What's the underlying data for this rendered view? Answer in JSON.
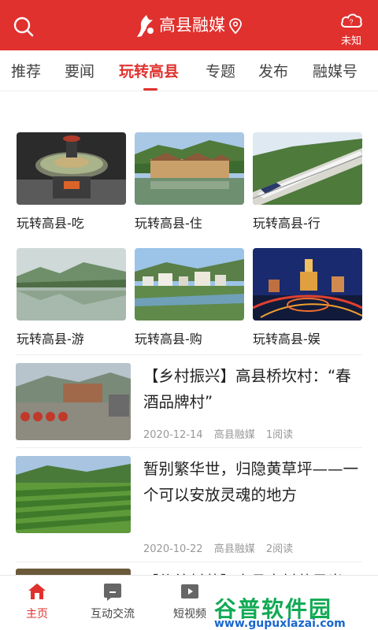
{
  "header": {
    "title": "高县融媒",
    "weather_label": "未知",
    "icons": [
      "search-icon",
      "logo-icon",
      "location-pin-icon",
      "weather-icon"
    ]
  },
  "tabs": [
    {
      "label": "推荐"
    },
    {
      "label": "要闻"
    },
    {
      "label": "玩转高县",
      "active": true
    },
    {
      "label": "专题"
    },
    {
      "label": "发布"
    },
    {
      "label": "融媒号"
    }
  ],
  "grid": [
    {
      "caption": "玩转高县-吃"
    },
    {
      "caption": "玩转高县-住"
    },
    {
      "caption": "玩转高县-行"
    },
    {
      "caption": "玩转高县-游"
    },
    {
      "caption": "玩转高县-购"
    },
    {
      "caption": "玩转高县-娱"
    }
  ],
  "news": [
    {
      "title": "【乡村振兴】高县桥坎村：“春酒品牌村”",
      "date": "2020-12-14",
      "source": "高县融媒",
      "reads": "1阅读"
    },
    {
      "title": "暂别繁华世，归隐黄草坪——一个可以安放灵魂的地方",
      "date": "2020-10-22",
      "source": "高县融媒",
      "reads": "2阅读"
    },
    {
      "title": "【传统村落】高县大村落风光"
    }
  ],
  "bottom_nav": [
    {
      "label": "主页",
      "icon": "home-icon",
      "active": true
    },
    {
      "label": "互动交流",
      "icon": "chat-icon"
    },
    {
      "label": "短视频",
      "icon": "video-icon"
    }
  ],
  "watermark": {
    "text": "谷普软件园",
    "url": "www.gupuxlazai.com"
  },
  "colors": {
    "brand": "#e0312e",
    "watermark_green": "#11aa55",
    "watermark_blue": "#1a66cc"
  }
}
